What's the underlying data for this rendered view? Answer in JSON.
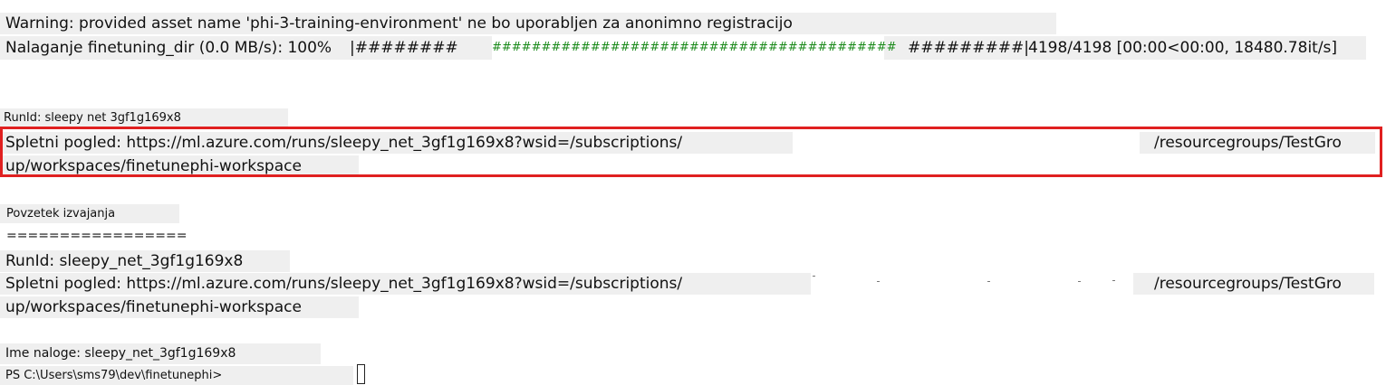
{
  "terminal": {
    "warning": "Warning: provided asset name 'phi-3-training-environment' ne bo uporabljen za anonimno registracijo",
    "upload_prefix": "Nalaganje finetuning_dir (0.0 MB/s): 100%",
    "progress_bar_left": "|########",
    "progress_bar_middle": "#########################################",
    "progress_bar_right": "#########|",
    "progress_stats": "4198/4198 [00:00<00:00, 18480.78it/s]",
    "run_id_top": "RunId: sleepy net 3gf1g169x8",
    "web_view_line1_part1": "Spletni pogled: https://ml.azure.com/runs/sleepy_net_3gf1g169x8?wsid=/subscriptions/",
    "web_view_line1_part2": "/resourcegroups/TestGro",
    "web_view_line2": "up/workspaces/finetunephi-workspace",
    "summary_heading": "Povzetek izvajanja",
    "summary_rule": "=================",
    "summary_run_id": "RunId: sleepy_net_3gf1g169x8",
    "summary_web_view_part1": "Spletni pogled: https://ml.azure.com/runs/sleepy_net_3gf1g169x8?wsid=/subscriptions/",
    "summary_web_view_part2": "/resourcegroups/TestGro",
    "summary_web_view_line2": "up/workspaces/finetunephi-workspace",
    "job_name": "Ime naloge: sleepy_net_3gf1g169x8",
    "prompt": "PS C:\\Users\\sms79\\dev\\finetunephi>"
  },
  "colors": {
    "highlight": "#efefef",
    "progress_green": "#1a8a1a",
    "callout_red": "#e02020"
  },
  "progress": {
    "percent": 100
  }
}
